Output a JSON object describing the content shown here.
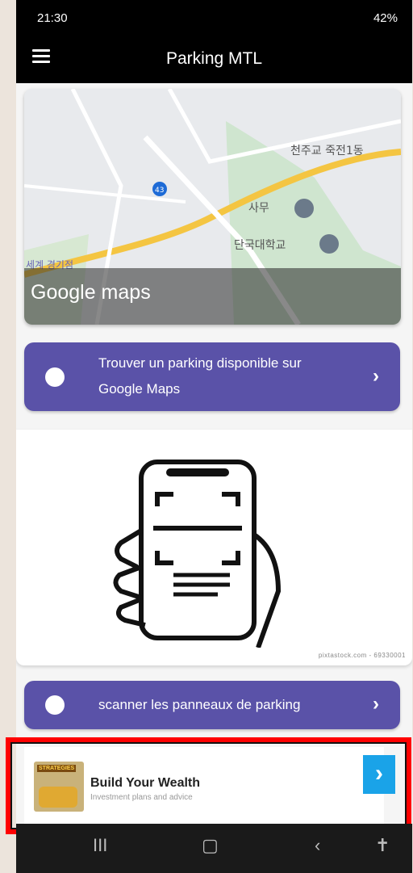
{
  "status_bar": {
    "time": "21:30",
    "right": "42%"
  },
  "app_bar": {
    "title": "Parking MTL"
  },
  "map_card": {
    "label": "Google maps",
    "map_labels": [
      "천주교 죽전1동",
      "사무",
      "단국대학교",
      "43",
      "세계 경기점"
    ]
  },
  "actions": [
    {
      "label": "Trouver un parking disponible sur Google Maps"
    },
    {
      "label": "scanner les panneaux de parking"
    }
  ],
  "scan_card": {
    "credit": "pixtastock.com - 69330001"
  },
  "ad": {
    "thumb_tag": "STRATEGIES",
    "headline": "Build Your Wealth",
    "subtext": "Investment plans and advice",
    "cta": "›"
  },
  "nav": {
    "recent": "III",
    "home": "▢",
    "back": "‹",
    "accessibility": "✝"
  },
  "colors": {
    "accent": "#5a52a8",
    "ad_cta": "#1aa3e8",
    "highlight": "#ff0000"
  }
}
